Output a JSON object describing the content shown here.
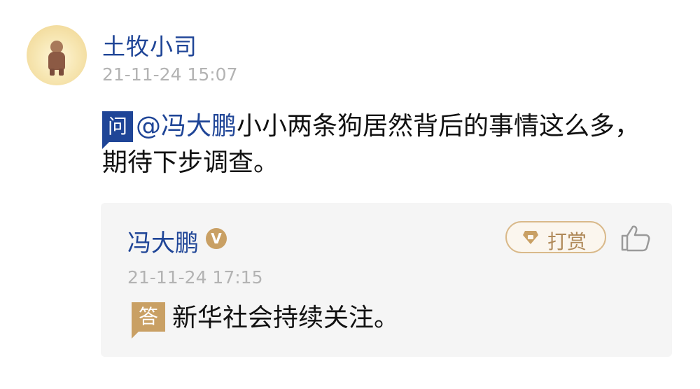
{
  "post": {
    "username": "土牧小司",
    "timestamp": "21-11-24 15:07",
    "question_badge": "问",
    "mention": "@冯大鹏",
    "question_text": "小小两条狗居然背后的事情这么多，期待下步调查。"
  },
  "reply": {
    "name": "冯大鹏",
    "verified_badge": "V",
    "tip_label": "打赏",
    "timestamp": "21-11-24 17:15",
    "answer_badge": "答",
    "answer_text": "新华社会持续关注。"
  },
  "icons": {
    "tip": "gem-icon",
    "like": "thumbs-up-icon",
    "verified": "verified-v-icon"
  },
  "colors": {
    "link_blue": "#1f4597",
    "gold": "#c9a064",
    "timestamp_gray": "#b3b3b3",
    "reply_bg": "#f5f5f5"
  }
}
